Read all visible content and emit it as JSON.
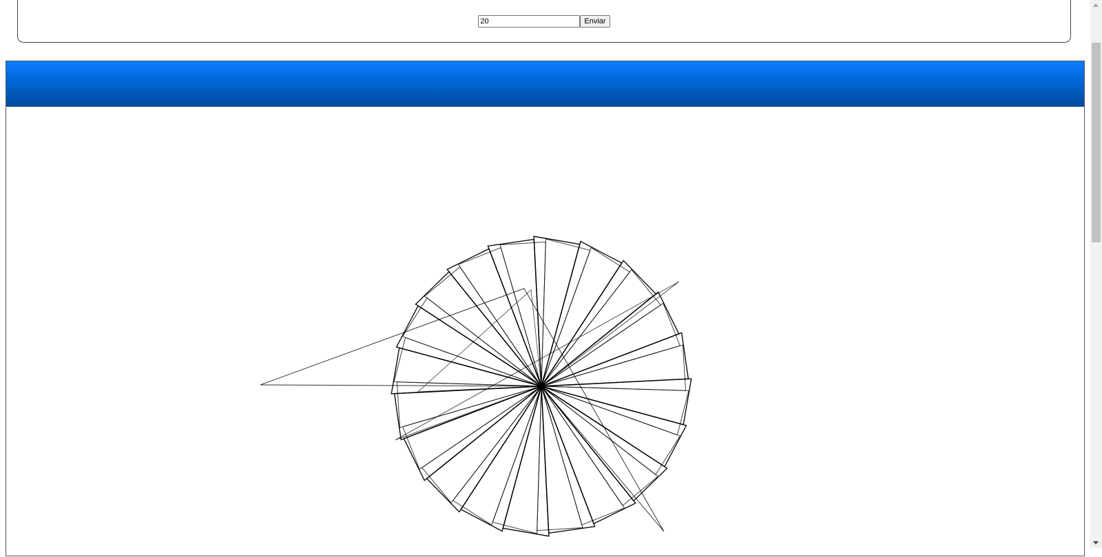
{
  "form": {
    "input_value": "20",
    "submit_label": "Enviar"
  },
  "header": {
    "color_top": "#0a7cff",
    "color_bottom": "#004a9c"
  },
  "drawing": {
    "stroke_color": "#000000"
  }
}
